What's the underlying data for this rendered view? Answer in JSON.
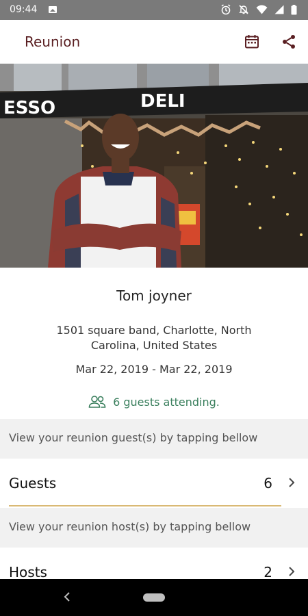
{
  "status_bar": {
    "time": "09:44",
    "icons": [
      "image-icon",
      "alarm-icon",
      "mute-icon",
      "wifi-icon",
      "signal-icon",
      "battery-icon"
    ]
  },
  "app_bar": {
    "title": "Reunion",
    "actions": [
      "calendar-icon",
      "share-icon"
    ],
    "accent_color": "#5a1f22"
  },
  "hero": {
    "storefront_sign_left": "ESSO",
    "storefront_sign_main": "DELI"
  },
  "event": {
    "name": "Tom joyner",
    "address": "1501 square band, Charlotte, North Carolina, United States",
    "dates": "Mar 22, 2019 - Mar 22, 2019",
    "guests_attending": "6 guests attending.",
    "guests_color": "#3a7f5d"
  },
  "sections": {
    "guests_hint": "View your reunion guest(s) by tapping bellow",
    "guests_label": "Guests",
    "guests_count": "6",
    "hosts_hint": "View your reunion host(s) by tapping bellow",
    "hosts_label": "Hosts",
    "hosts_count": "2",
    "divider_color": "#d9b974"
  }
}
